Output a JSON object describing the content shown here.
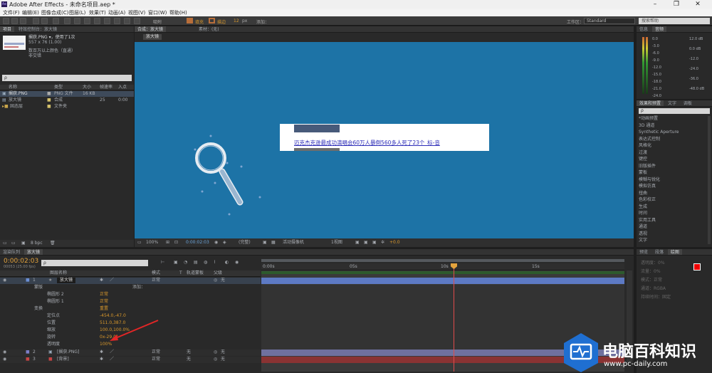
{
  "window": {
    "title": "Adobe After Effects - 未命名项目.aep *",
    "app_badge": "Ae"
  },
  "menu": [
    "文件(F)",
    "编辑(E)",
    "图像合成(C)",
    "图层(L)",
    "效果(T)",
    "动画(A)",
    "视图(V)",
    "窗口(W)",
    "帮助(H)"
  ],
  "toolbar": {
    "snap_label": "吸附",
    "opt1": "填充",
    "opt2": "描边",
    "stroke_px": "12",
    "stroke_unit": "px",
    "add_label": "添加：",
    "workspace_label": "工作区：",
    "workspace_value": "Standard",
    "search_placeholder": "搜索帮助"
  },
  "project": {
    "tabs": [
      "项目",
      "特效控制台：放大镜"
    ],
    "selected_name": "搁获.PNG ▾，使用了1次",
    "selected_size": "557 x 76 (1.00)",
    "selected_info1": "数百万以上颜色（直通）",
    "selected_info2": "非交错",
    "search_placeholder": "ρ",
    "columns": [
      "名称",
      "类型",
      "大小",
      "帧速率",
      "入点"
    ],
    "items": [
      {
        "name": "搁获.PNG",
        "type": "PNG 文件",
        "size": "16 KB",
        "fps": "",
        "in": ""
      },
      {
        "name": "放大镜",
        "type": "合成",
        "size": "",
        "fps": "25",
        "in": "0:00"
      },
      {
        "name": "固态层",
        "type": "文件夹",
        "size": "",
        "fps": "",
        "in": ""
      }
    ],
    "bpc": "8 bpc"
  },
  "composition": {
    "tabs": [
      "合成：放大镜",
      "素材：(无)"
    ],
    "comp_name": "放大镜",
    "banner_text": "迈克杰克逊最成功演唱会60万人暴倒560多人死了23个_标-音",
    "bottom": {
      "zoom": "100%",
      "timecode": "0:00:02:03",
      "resolution": "(完整)",
      "camera": "活动摄像机",
      "views": "1视图",
      "exposure": "+0.0"
    }
  },
  "info": {
    "tabs": [
      "信息",
      "音频"
    ],
    "levels_left": [
      "0.0",
      "-3.0",
      "-6.0",
      "-9.0",
      "-12.0",
      "-15.0",
      "-18.0",
      "-21.0",
      "-24.0"
    ],
    "levels_right": [
      "12.0 dB",
      "0.0 dB",
      "-12.0",
      "-24.0",
      "-36.0",
      "-48.0 dB"
    ]
  },
  "effects": {
    "tabs": [
      "效果和预置",
      "文字",
      "调板"
    ],
    "search_placeholder": "ρ",
    "items": [
      "*动画预置",
      "3D 通道",
      "Synthetic Aperture",
      "表达式控制",
      "风格化",
      "过渡",
      "键控",
      "旧版插件",
      "蒙板",
      "模糊与锐化",
      "模拟仿真",
      "扭曲",
      "色彩校正",
      "生成",
      "时间",
      "实用工具",
      "通道",
      "透视",
      "文字"
    ]
  },
  "timeline": {
    "tabs": [
      "渲染队列",
      "放大镜"
    ],
    "timecode": "0:00:02:03",
    "frame_info": "00053 (25.00 fps)",
    "search_placeholder": "ρ",
    "columns": [
      "图层名称",
      "模式",
      "T",
      "轨道蒙板",
      "父级"
    ],
    "ruler": [
      "0:00s",
      "05s",
      "10s",
      "15s"
    ],
    "layers": [
      {
        "num": "1",
        "name": "放大镜",
        "mode": "正常",
        "parent": "无",
        "color": "#6b8fd6"
      },
      {
        "num": "2",
        "name": "[搁获.PNG]",
        "mode": "正常",
        "trk": "无",
        "parent": "无",
        "color": "#7d7fc8"
      },
      {
        "num": "3",
        "name": "[背景]",
        "mode": "正常",
        "trk": "无",
        "parent": "无",
        "color": "#c64545"
      }
    ],
    "props": [
      {
        "label": "蒙版",
        "value": "",
        "indent": 1
      },
      {
        "label": "椭圆形 2",
        "value": "正常",
        "indent": 2
      },
      {
        "label": "椭圆形 1",
        "value": "正常",
        "indent": 2
      },
      {
        "label": "变换",
        "value": "重置",
        "indent": 1
      },
      {
        "label": "定位点",
        "value": "-454.0,-47.0",
        "indent": 2
      },
      {
        "label": "位置",
        "value": "511.0,387.0",
        "indent": 2
      },
      {
        "label": "缩放",
        "value": "100.0,100.0%",
        "indent": 2
      },
      {
        "label": "旋转",
        "value": "0x-29.0°",
        "indent": 2
      },
      {
        "label": "透明度",
        "value": "100%",
        "indent": 2
      }
    ],
    "add_label": "添加："
  },
  "right_bottom": {
    "tabs": [
      "预览",
      "段落",
      "绘图"
    ],
    "rows": [
      "透明度：0%",
      "流量：0%",
      "模式：正常",
      "通道：RGBA",
      "持续时间：固定"
    ]
  },
  "watermark": {
    "title": "电脑百科知识",
    "url": "www.pc-daily.com"
  },
  "colors": {
    "comp_bg": "#1d73a6",
    "accent": "#d9982b",
    "layer3": "#c64545"
  }
}
